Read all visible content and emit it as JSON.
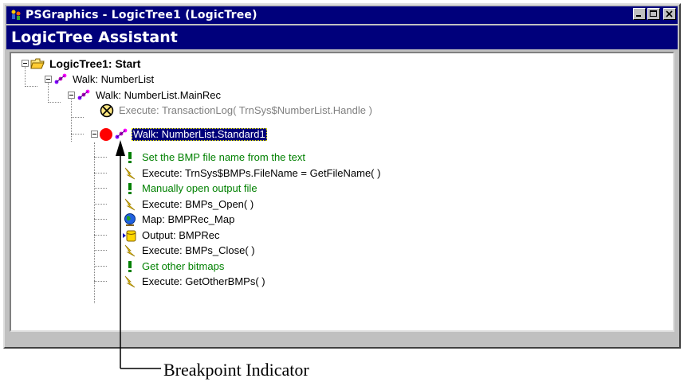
{
  "window": {
    "title": "PSGraphics - LogicTree1 (LogicTree)"
  },
  "panel": {
    "title": "LogicTree Assistant"
  },
  "tree": {
    "root": "LogicTree1: Start",
    "walk1": "Walk: NumberList",
    "walk2": "Walk: NumberList.MainRec",
    "exec_log": "Execute: TransactionLog( TrnSys$NumberList.Handle )",
    "walk3": "Walk: NumberList.Standard1",
    "children": [
      {
        "label": "Set the BMP file name from the text",
        "icon": "comment-icon",
        "style": "green"
      },
      {
        "label": "Execute: TrnSys$BMPs.FileName = GetFileName( )",
        "icon": "execute-icon",
        "style": "normal"
      },
      {
        "label": "Manually open output file",
        "icon": "comment-icon",
        "style": "green"
      },
      {
        "label": "Execute: BMPs_Open( )",
        "icon": "execute-icon",
        "style": "normal"
      },
      {
        "label": "Map: BMPRec_Map",
        "icon": "globe-map-icon",
        "style": "normal"
      },
      {
        "label": "Output: BMPRec",
        "icon": "output-icon",
        "style": "normal"
      },
      {
        "label": "Execute: BMPs_Close( )",
        "icon": "execute-icon",
        "style": "normal"
      },
      {
        "label": "Get other bitmaps",
        "icon": "comment-icon",
        "style": "green"
      },
      {
        "label": "Execute: GetOtherBMPs( )",
        "icon": "execute-icon",
        "style": "normal"
      }
    ]
  },
  "annotation": {
    "callout": "Breakpoint Indicator"
  },
  "colors": {
    "titlebar": "#00007b",
    "comment": "#008000",
    "breakpoint": "#ff0000"
  }
}
